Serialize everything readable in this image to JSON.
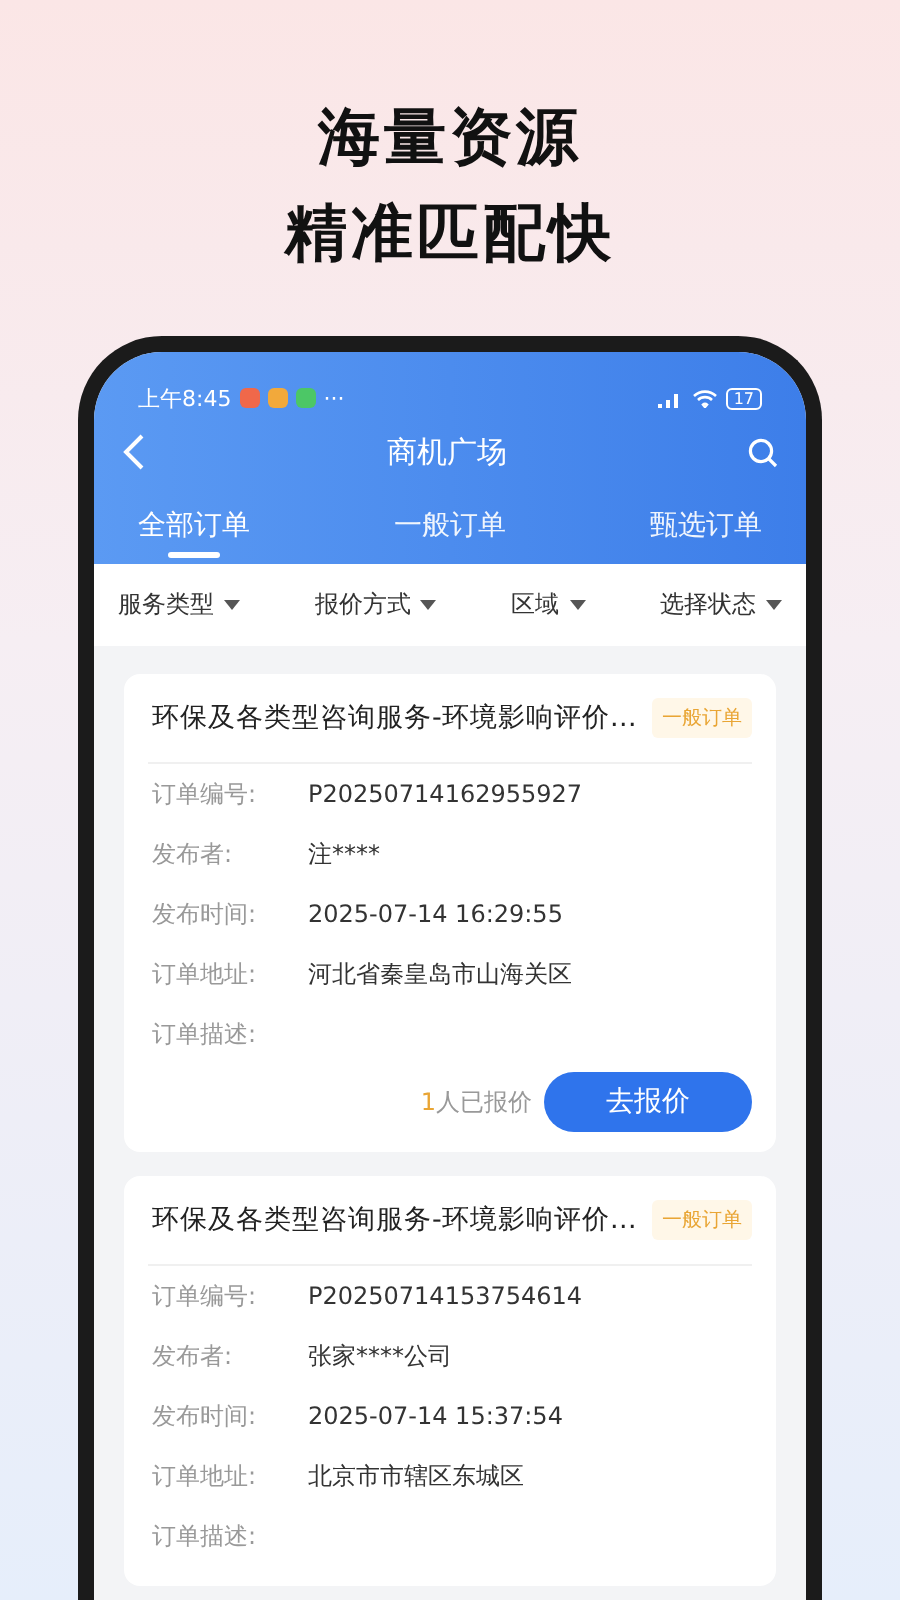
{
  "headline": [
    "海量资源",
    "精准匹配快"
  ],
  "status_bar": {
    "time": "上午8:45",
    "notifications": [
      {
        "color": "#f0684a"
      },
      {
        "color": "#f2a93b"
      },
      {
        "color": "#4cc766"
      }
    ],
    "more": "···",
    "battery": "17"
  },
  "nav": {
    "title": "商机广场"
  },
  "tabs": [
    {
      "label": "全部订单",
      "selected": true
    },
    {
      "label": "一般订单",
      "selected": false
    },
    {
      "label": "甄选订单",
      "selected": false
    }
  ],
  "filters": [
    "服务类型",
    "报价方式",
    "区域",
    "选择状态"
  ],
  "orders": [
    {
      "title": "环保及各类型咨询服务-环境影响评价…",
      "tag": "一般订单",
      "fields": [
        {
          "label": "订单编号:",
          "value": "P20250714162955927"
        },
        {
          "label": "发布者:",
          "value": "注****"
        },
        {
          "label": "发布时间:",
          "value": "2025-07-14 16:29:55"
        },
        {
          "label": "订单地址:",
          "value": "河北省秦皇岛市山海关区"
        },
        {
          "label": "订单描述:"
        }
      ],
      "quote_count": "1",
      "quote_suffix": "人已报价",
      "action": "去报价"
    },
    {
      "title": "环保及各类型咨询服务-环境影响评价…",
      "tag": "一般订单",
      "fields": [
        {
          "label": "订单编号:",
          "value": "P20250714153754614"
        },
        {
          "label": "发布者:",
          "value": "张家****公司"
        },
        {
          "label": "发布时间:",
          "value": "2025-07-14 15:37:54"
        },
        {
          "label": "订单地址:",
          "value": "北京市市辖区东城区"
        },
        {
          "label": "订单描述:"
        }
      ]
    }
  ]
}
